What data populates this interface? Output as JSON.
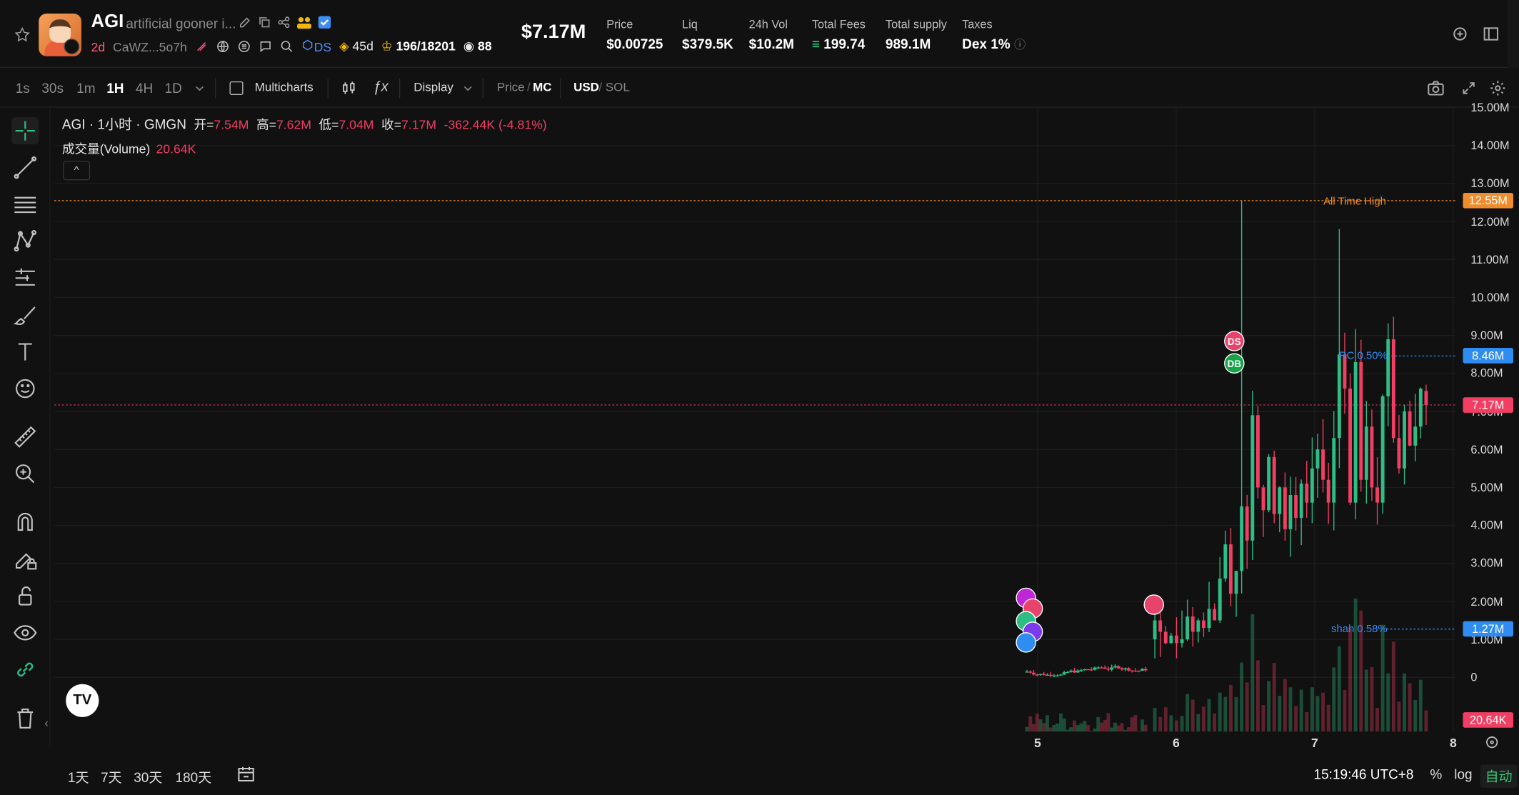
{
  "token": {
    "ticker": "AGI",
    "name": "artificial gooner i...",
    "age": "2d",
    "address": "CaWZ...5o7h",
    "dex_tag": "DS",
    "bnb_age": "45d",
    "holders": "196/18201",
    "views": "88"
  },
  "stats": {
    "market_cap": "$7.17M",
    "price_label": "Price",
    "price": "$0.00725",
    "liq_label": "Liq",
    "liq": "$379.5K",
    "vol_label": "24h Vol",
    "vol": "$10.2M",
    "fees_label": "Total Fees",
    "fees": "199.74",
    "supply_label": "Total supply",
    "supply": "989.1M",
    "taxes_label": "Taxes",
    "taxes": "Dex 1%"
  },
  "toolbar": {
    "timeframes": [
      "1s",
      "30s",
      "1m",
      "1H",
      "4H",
      "1D"
    ],
    "active_timeframe": "1H",
    "multicharts": "Multicharts",
    "display": "Display",
    "price": "Price",
    "slash": "/",
    "mc": "MC",
    "usd": "USD",
    "sol": "SOL"
  },
  "legend": {
    "symbol": "AGI · 1小时 · GMGN",
    "open_k": "开=",
    "open": "7.54M",
    "high_k": "高=",
    "high": "7.62M",
    "low_k": "低=",
    "low": "7.04M",
    "close_k": "收=",
    "close": "7.17M",
    "change": "-362.44K (-4.81%)",
    "volume_label": "成交量(Volume)",
    "volume": "20.64K"
  },
  "chart_data": {
    "type": "candlestick",
    "x_ticks": [
      "5",
      "6",
      "7",
      "8"
    ],
    "y_ticks": [
      "0",
      "1.00M",
      "2.00M",
      "3.00M",
      "4.00M",
      "5.00M",
      "6.00M",
      "7.00M",
      "8.00M",
      "9.00M",
      "10.00M",
      "11.00M",
      "12.00M",
      "13.00M",
      "14.00M",
      "15.00M"
    ],
    "ylim": [
      0,
      15
    ],
    "tags": {
      "ath": "12.55M",
      "rc": "8.46M",
      "last": "7.17M",
      "shah": "1.27M",
      "volume": "20.64K"
    },
    "annotations": {
      "ath": "All Time High",
      "rc": "RC 0.50%",
      "shah": "shah 0.58%"
    }
  },
  "bottom": {
    "ranges": [
      "1天",
      "7天",
      "30天",
      "180天"
    ],
    "clock": "15:19:46 UTC+8",
    "percent": "%",
    "log": "log",
    "auto": "自动"
  },
  "colors": {
    "up": "#2ebd85",
    "down": "#f23e62",
    "ath": "#f08c2b",
    "blue": "#2f8cf0"
  }
}
